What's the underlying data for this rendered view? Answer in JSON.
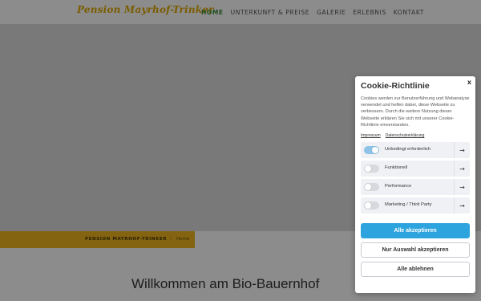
{
  "header": {
    "logo": "Pension Mayrhof-Trinker",
    "nav": [
      {
        "label": "HOME",
        "active": true
      },
      {
        "label": "UNTERKUNFT & PREISE",
        "active": false
      },
      {
        "label": "GALERIE",
        "active": false
      },
      {
        "label": "ERLEBNIS",
        "active": false
      },
      {
        "label": "KONTAKT",
        "active": false
      }
    ]
  },
  "breadcrumb": {
    "title": "PENSION MAYRHOF-TRINKER",
    "separator": "›",
    "home": "Home"
  },
  "main": {
    "welcome": "Willkommen am Bio-Bauernhof"
  },
  "cookie": {
    "title": "Cookie-Richtlinie",
    "close": "x",
    "text": "Cookies werden zur Benutzerführung und Webanalyse verwendet und helfen dabei, diese Webseite zu verbessern. Durch die weitere Nutzung dieser Webseite erklären Sie sich mit unserer Cookie-Richtlinie einverstanden.",
    "links": [
      "Impressum",
      "Datenschutzerklärung"
    ],
    "categories": [
      {
        "label": "Unbedingt erforderlich",
        "enabled": true
      },
      {
        "label": "Funktionell",
        "enabled": false
      },
      {
        "label": "Performance",
        "enabled": false
      },
      {
        "label": "Marketing / Third Party",
        "enabled": false
      }
    ],
    "arrow": "→",
    "buttons": {
      "accept_all": "Alle akzeptieren",
      "accept_selection": "Nur Auswahl akzeptieren",
      "reject_all": "Alle ablehnen"
    }
  },
  "colors": {
    "logo": "#e0a800",
    "nav_active": "#3f8f3f",
    "breadcrumb_bar": "#f1b720",
    "primary_button": "#2ea4de",
    "toggle_on": "#8ec2e6"
  }
}
